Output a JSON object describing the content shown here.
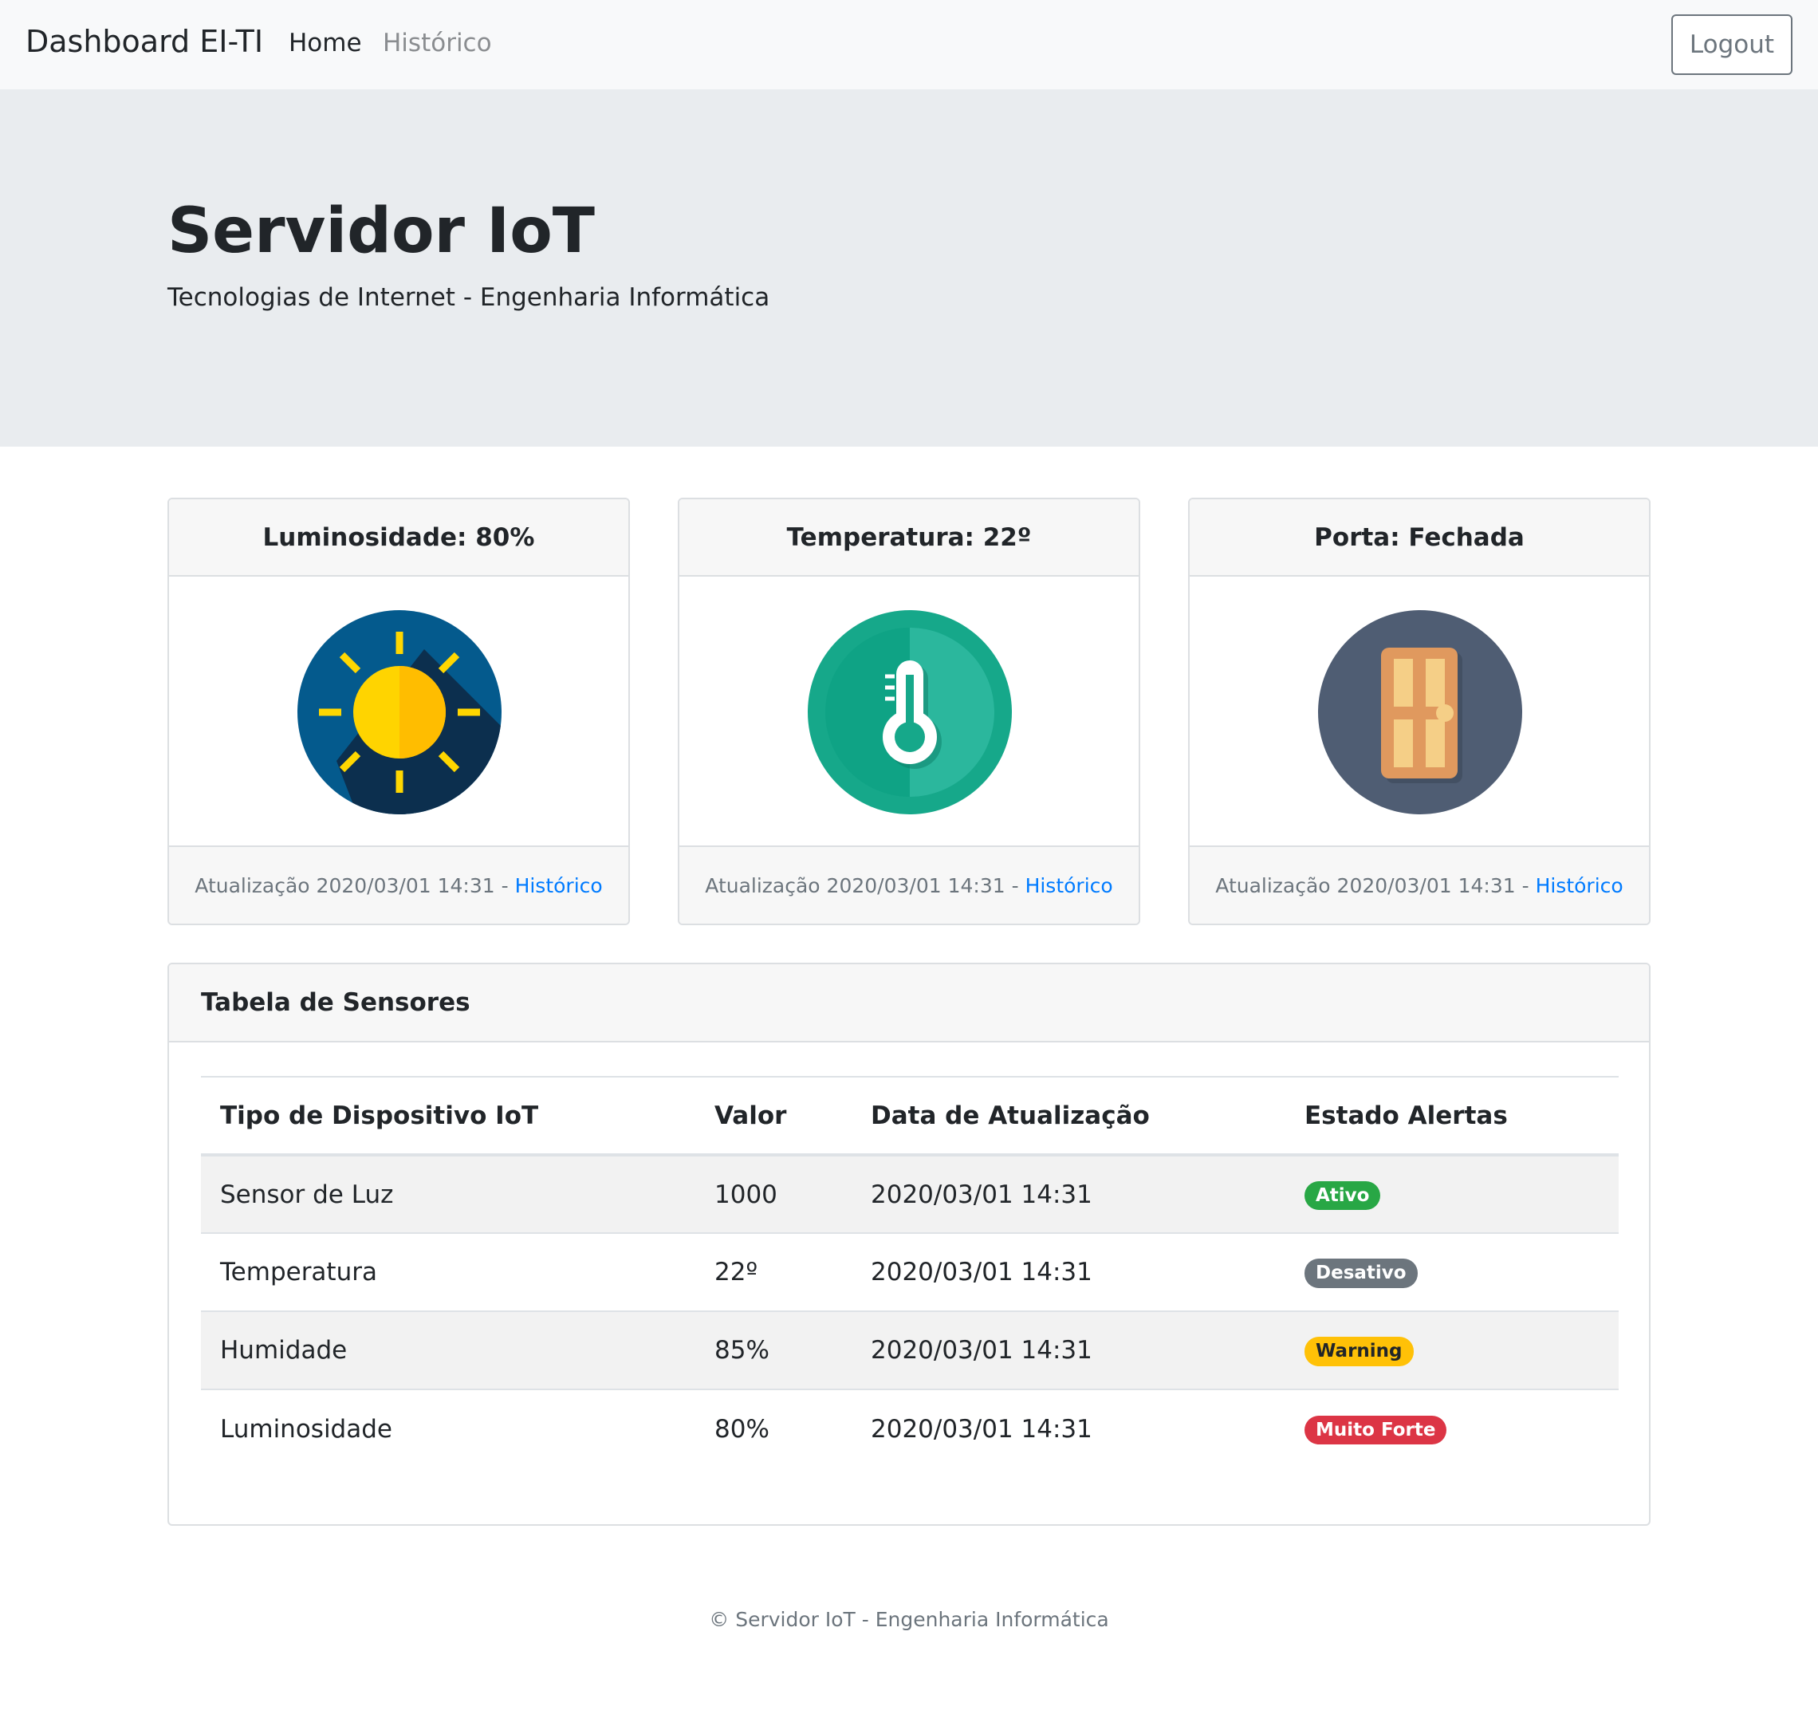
{
  "navbar": {
    "brand": "Dashboard EI-TI",
    "links": [
      "Home",
      "Histórico"
    ],
    "logout_label": "Logout"
  },
  "jumbotron": {
    "title": "Servidor IoT",
    "subtitle": "Tecnologias de Internet - Engenharia Informática"
  },
  "cards": [
    {
      "title": "Luminosidade: 80%",
      "icon": "sun-icon",
      "footer_text": "Atualização 2020/03/01 14:31 - ",
      "footer_link": "Histórico"
    },
    {
      "title": "Temperatura: 22º",
      "icon": "thermometer-icon",
      "footer_text": "Atualização 2020/03/01 14:31 - ",
      "footer_link": "Histórico"
    },
    {
      "title": "Porta: Fechada",
      "icon": "door-icon",
      "footer_text": "Atualização 2020/03/01 14:31 - ",
      "footer_link": "Histórico"
    }
  ],
  "sensor_table": {
    "title": "Tabela de Sensores",
    "columns": [
      "Tipo de Dispositivo IoT",
      "Valor",
      "Data de Atualização",
      "Estado Alertas"
    ],
    "rows": [
      {
        "device": "Sensor de Luz",
        "value": "1000",
        "date": "2020/03/01 14:31",
        "status": "Ativo",
        "status_color": "#28a745"
      },
      {
        "device": "Temperatura",
        "value": "22º",
        "date": "2020/03/01 14:31",
        "status": "Desativo",
        "status_color": "#6c757d"
      },
      {
        "device": "Humidade",
        "value": "85%",
        "date": "2020/03/01 14:31",
        "status": "Warning",
        "status_color": "#ffc107"
      },
      {
        "device": "Luminosidade",
        "value": "80%",
        "date": "2020/03/01 14:31",
        "status": "Muito Forte",
        "status_color": "#dc3545"
      }
    ]
  },
  "footer": {
    "text": "© Servidor IoT - Engenharia Informática"
  },
  "colors": {
    "link": "#007bff",
    "navbar_bg": "#f8f9fa",
    "jumbotron_bg": "#e9ecef"
  }
}
